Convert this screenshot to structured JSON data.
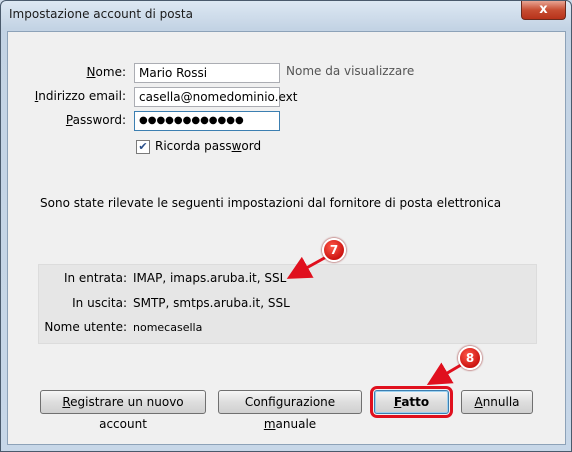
{
  "window": {
    "title": "Impostazione account di posta",
    "close_glyph": "x"
  },
  "form": {
    "name_label_accel": "N",
    "name_label_rest": "ome:",
    "name_value": "Mario Rossi",
    "name_hint": "Nome da visualizzare",
    "email_label_accel": "I",
    "email_label_rest": "ndirizzo email:",
    "email_value": "casella@nomedominio.ext",
    "password_label_accel": "P",
    "password_label_rest": "assword:",
    "password_value": "●●●●●●●●●●●●",
    "remember_label_pre": "Ricorda pass",
    "remember_label_accel": "w",
    "remember_label_post": "ord",
    "remember_checked": true
  },
  "info_text": "Sono state rilevate le seguenti impostazioni dal fornitore di posta elettronica",
  "settings": {
    "incoming_label": "In entrata:",
    "incoming_value": "IMAP, imaps.aruba.it, SSL",
    "outgoing_label": "In uscita:",
    "outgoing_value": "SMTP, smtps.aruba.it, SSL",
    "username_label": "Nome utente:",
    "username_value": "nomecasella"
  },
  "buttons": {
    "register_accel": "R",
    "register_rest": "egistrare un nuovo account",
    "manual_pre": "Configurazione ",
    "manual_accel": "m",
    "manual_post": "anuale",
    "done_accel": "F",
    "done_rest": "atto",
    "cancel_accel": "A",
    "cancel_rest": "nnulla"
  },
  "annotations": {
    "badge_7": "7",
    "badge_8": "8"
  },
  "colors": {
    "annotation_red": "#e0101e",
    "title_gradient_top": "#dde8f3",
    "close_red": "#c74d32"
  }
}
